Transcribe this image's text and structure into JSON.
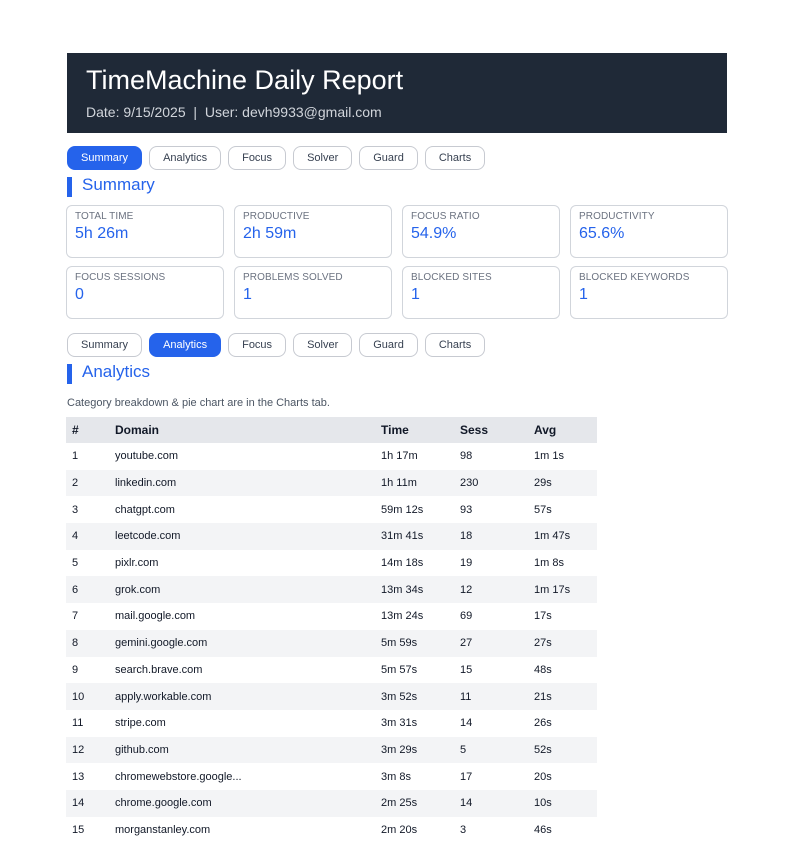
{
  "header": {
    "title": "TimeMachine Daily Report",
    "meta": "Date: 9/15/2025  |  User: devh9933@gmail.com"
  },
  "tabs": [
    "Summary",
    "Analytics",
    "Focus",
    "Solver",
    "Guard",
    "Charts"
  ],
  "summary": {
    "title": "Summary",
    "cards": [
      {
        "label": "Total Time",
        "value": "5h 26m"
      },
      {
        "label": "Productive",
        "value": "2h 59m"
      },
      {
        "label": "Focus Ratio",
        "value": "54.9%"
      },
      {
        "label": "Productivity",
        "value": "65.6%"
      },
      {
        "label": "Focus Sessions",
        "value": "0"
      },
      {
        "label": "Problems Solved",
        "value": "1"
      },
      {
        "label": "Blocked Sites",
        "value": "1"
      },
      {
        "label": "Blocked Keywords",
        "value": "1"
      }
    ]
  },
  "analytics": {
    "title": "Analytics",
    "note": "Category breakdown & pie chart are in the Charts tab.",
    "columns": [
      "#",
      "Domain",
      "Time",
      "Sess",
      "Avg"
    ],
    "rows": [
      [
        "1",
        "youtube.com",
        "1h 17m",
        "98",
        "1m 1s"
      ],
      [
        "2",
        "linkedin.com",
        "1h 11m",
        "230",
        "29s"
      ],
      [
        "3",
        "chatgpt.com",
        "59m 12s",
        "93",
        "57s"
      ],
      [
        "4",
        "leetcode.com",
        "31m 41s",
        "18",
        "1m 47s"
      ],
      [
        "5",
        "pixlr.com",
        "14m 18s",
        "19",
        "1m 8s"
      ],
      [
        "6",
        "grok.com",
        "13m 34s",
        "12",
        "1m 17s"
      ],
      [
        "7",
        "mail.google.com",
        "13m 24s",
        "69",
        "17s"
      ],
      [
        "8",
        "gemini.google.com",
        "5m 59s",
        "27",
        "27s"
      ],
      [
        "9",
        "search.brave.com",
        "5m 57s",
        "15",
        "48s"
      ],
      [
        "10",
        "apply.workable.com",
        "3m 52s",
        "11",
        "21s"
      ],
      [
        "11",
        "stripe.com",
        "3m 31s",
        "14",
        "26s"
      ],
      [
        "12",
        "github.com",
        "3m 29s",
        "5",
        "52s"
      ],
      [
        "13",
        "chromewebstore.google...",
        "3m 8s",
        "17",
        "20s"
      ],
      [
        "14",
        "chrome.google.com",
        "2m 25s",
        "14",
        "10s"
      ],
      [
        "15",
        "morganstanley.com",
        "2m 20s",
        "3",
        "46s"
      ]
    ]
  },
  "colors": {
    "accent": "#2563eb",
    "header_bg": "#1f2937"
  }
}
